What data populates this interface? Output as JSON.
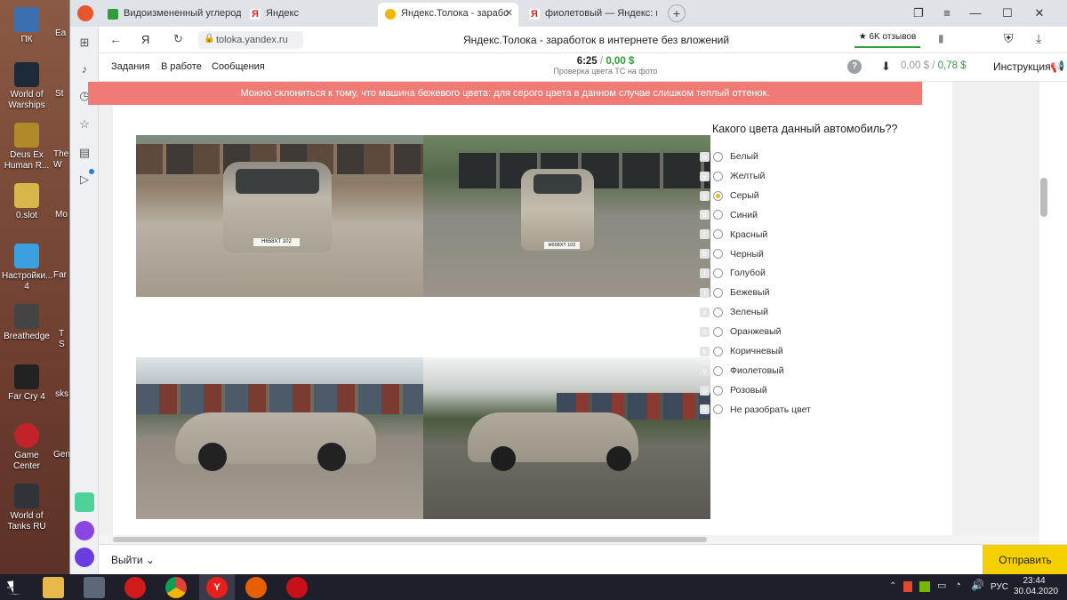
{
  "desktop": {
    "icons": [
      {
        "label": "ПК"
      },
      {
        "label": "World of Warships"
      },
      {
        "label": "Deus Ex Human R..."
      },
      {
        "label": "0.slot"
      },
      {
        "label": "Настройки... 4"
      },
      {
        "label": "Breathedge"
      },
      {
        "label": "Far Cry 4"
      },
      {
        "label": "Game Center"
      },
      {
        "label": "World of Tanks RU"
      }
    ],
    "clipped": [
      "Ea",
      "St",
      "The W",
      "Mo",
      "Far",
      "T S",
      "sks",
      "Gen"
    ]
  },
  "browser": {
    "tabs": [
      {
        "label": "Видоизмененный углерод",
        "icon": "hd-video-icon",
        "color": "#2e9d3a"
      },
      {
        "label": "Яндекс",
        "icon": "yandex-icon",
        "color": "#e8201a"
      },
      {
        "label": "Яндекс.Толока - зарабо",
        "icon": "toloka-icon",
        "color": "#f5b400"
      },
      {
        "label": "фиолетовый — Яндекс: на",
        "icon": "yandex-icon",
        "color": "#e8201a"
      }
    ],
    "new_tab_glyph": "+",
    "address": {
      "url": "toloka.yandex.ru",
      "page_title": "Яндекс.Толока - заработок в интернете без вложений",
      "reviews": "6K отзывов"
    }
  },
  "toloka": {
    "nav": [
      "Задания",
      "В работе",
      "Сообщения"
    ],
    "timer": "6:25",
    "timer_sep": "/",
    "task_reward": "0,00 $",
    "task_name": "Проверка цвета ТС на фото",
    "help_glyph": "?",
    "balance": "0,00 $",
    "balance_sep": "/",
    "earned": "0,78 $",
    "instruction": "Инструкция",
    "alert": "Можно склониться к тому, что машина бежевого цвета: для серого цвета в данном случае слишком теплый оттенок.",
    "question": "Какого цвета данный автомобиль??",
    "plates": [
      "Н658ХТ 102",
      "Н658ХТ 102"
    ],
    "options": [
      {
        "key": "w",
        "label": "Белый",
        "selected": false
      },
      {
        "key": "y",
        "label": "Желтый",
        "selected": false
      },
      {
        "key": "g",
        "label": "Серый",
        "selected": true
      },
      {
        "key": "d",
        "label": "Синий",
        "selected": false
      },
      {
        "key": "r",
        "label": "Красный",
        "selected": false
      },
      {
        "key": "b",
        "label": "Черный",
        "selected": false
      },
      {
        "key": "l",
        "label": "Голубой",
        "selected": false
      },
      {
        "key": "t",
        "label": "Бежевый",
        "selected": false
      },
      {
        "key": "z",
        "label": "Зеленый",
        "selected": false
      },
      {
        "key": "o",
        "label": "Оранжевый",
        "selected": false
      },
      {
        "key": "k",
        "label": "Коричневый",
        "selected": false
      },
      {
        "key": "v",
        "label": "Фиолетовый",
        "selected": false
      },
      {
        "key": "p",
        "label": "Розовый",
        "selected": false
      },
      {
        "key": "0",
        "label": "Не разобрать цвет",
        "selected": false
      }
    ],
    "exit_label": "Выйти",
    "submit_label": "Отправить"
  },
  "taskbar": {
    "lang": "РУС",
    "time": "23:44",
    "date": "30.04.2020"
  },
  "colors": {
    "accent": "#f5b400",
    "alert": "#f07b74",
    "green": "#2e9d3a"
  }
}
